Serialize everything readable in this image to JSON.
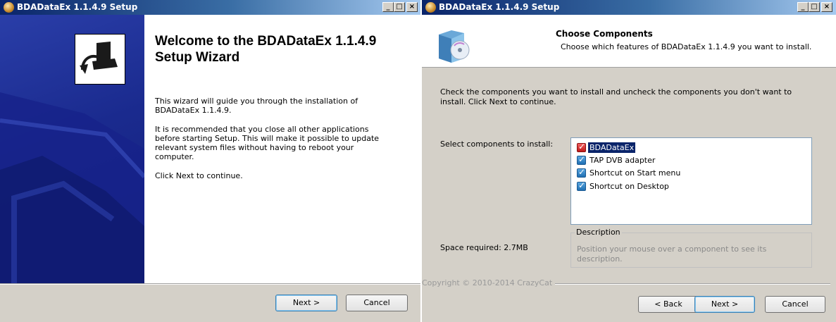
{
  "left": {
    "title": "BDADataEx 1.1.4.9 Setup",
    "heading_line1": "Welcome to the BDADataEx 1.1.4.9",
    "heading_line2": "Setup Wizard",
    "para1_line1": "This wizard will guide you through the installation of",
    "para1_line2": "BDADataEx 1.1.4.9.",
    "para2_line1": "It is recommended that you close all other applications",
    "para2_line2": "before starting Setup. This will make it possible to update",
    "para2_line3": "relevant system files without having to reboot your",
    "para2_line4": "computer.",
    "para3": "Click Next to continue.",
    "next_label": "Next >",
    "cancel_label": "Cancel"
  },
  "right": {
    "title": "BDADataEx 1.1.4.9 Setup",
    "header_title": "Choose Components",
    "header_subtitle": "Choose which features of BDADataEx 1.1.4.9 you want to install.",
    "instructions_line1": "Check the components you want to install and uncheck the components you don't want to",
    "instructions_line2": "install. Click Next to continue.",
    "select_label": "Select components to install:",
    "components": [
      "BDADataEx",
      "TAP DVB adapter",
      "Shortcut on Start menu",
      "Shortcut on Desktop"
    ],
    "description_legend": "Description",
    "description_line1": "Position your mouse over a component to see its",
    "description_line2": "description.",
    "space_required": "Space required: 2.7MB",
    "copyright": "Copyright © 2010-2014 CrazyCat",
    "back_label": "< Back",
    "next_label": "Next >",
    "cancel_label": "Cancel"
  },
  "colors": {
    "titlebar_start": "#0a246a",
    "titlebar_end": "#a6caf0",
    "sidebar_blue": "#1f2f9a",
    "selection": "#0a246a"
  },
  "icons": [
    "installer-app-icon",
    "minimize-icon",
    "maximize-icon",
    "close-icon",
    "computer-install-icon",
    "software-box-cd-icon",
    "checkbox-icon"
  ]
}
